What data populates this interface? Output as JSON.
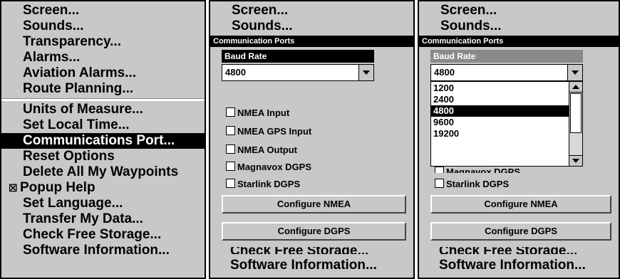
{
  "menu": {
    "items_top": [
      "Screen...",
      "Sounds...",
      "Transparency...",
      "Alarms...",
      "Aviation Alarms...",
      "Route Planning..."
    ],
    "items_bottom": [
      "Units of Measure...",
      "Set Local Time...",
      "Communications Port...",
      "Reset Options",
      "Delete All My Waypoints",
      "Popup Help",
      "Set Language...",
      "Transfer My Data...",
      "Check Free Storage...",
      "Software Information..."
    ],
    "selected": "Communications Port...",
    "popup_help_checked": "☒"
  },
  "dialog": {
    "menu_above": [
      "Screen...",
      "Sounds..."
    ],
    "title": "Communication Ports",
    "baud_label": "Baud Rate",
    "baud_value": "4800",
    "checkboxes": [
      "NMEA Input",
      "NMEA GPS Input",
      "NMEA Output",
      "Magnavox DGPS",
      "Starlink DGPS"
    ],
    "configure_nmea": "Configure NMEA",
    "configure_dgps": "Configure DGPS",
    "menu_below": [
      "Check Free Storage...",
      "Software Information..."
    ]
  },
  "dropdown_open": {
    "options": [
      "1200",
      "2400",
      "4800",
      "9600",
      "19200"
    ],
    "selected": "4800",
    "partial_checkbox": "Magnavox DGPS"
  },
  "colors": {
    "panel_bg": "#c8c8c8",
    "highlight": "#000000",
    "label_bar_active": "#000000",
    "label_bar_inactive": "#8a8a8a"
  }
}
